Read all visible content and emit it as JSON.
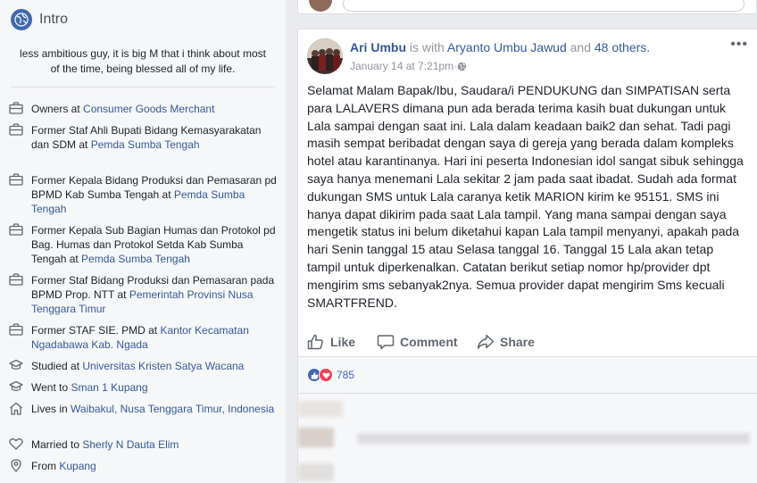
{
  "intro": {
    "title": "Intro",
    "bio": "less ambitious guy, it is big M that i think about most of the time, being blessed all of my life.",
    "items": [
      {
        "icon": "briefcase-icon",
        "prefix": "Owners at ",
        "link": "Consumer Goods Merchant",
        "suffix": ""
      },
      {
        "icon": "briefcase-icon",
        "prefix": "Former Staf Ahli Bupati Bidang Kemasyarakatan dan SDM at ",
        "link": "Pemda Sumba Tengah",
        "suffix": ""
      },
      {
        "icon": "briefcase-icon",
        "prefix": "Former Kepala Bidang Produksi dan Pemasaran pd BPMD Kab Sumba Tengah at ",
        "link": "Pemda Sumba Tengah",
        "suffix": ""
      },
      {
        "icon": "briefcase-icon",
        "prefix": "Former Kepala Sub Bagian Humas dan Protokol pd Bag. Humas dan Protokol Setda Kab Sumba Tengah at ",
        "link": "Pemda Sumba Tengah",
        "suffix": ""
      },
      {
        "icon": "briefcase-icon",
        "prefix": "Former Staf Bidang Produksi dan Pemasaran pada BPMD Prop. NTT at ",
        "link": "Pemerintah Provinsi Nusa Tenggara Timur",
        "suffix": ""
      },
      {
        "icon": "briefcase-icon",
        "prefix": "Former STAF SIE. PMD at ",
        "link": "Kantor Kecamatan Ngadabawa Kab. Ngada",
        "suffix": ""
      },
      {
        "icon": "graduation-cap-icon",
        "prefix": "Studied at ",
        "link": "Universitas Kristen Satya Wacana",
        "suffix": ""
      },
      {
        "icon": "graduation-cap-icon",
        "prefix": "Went to ",
        "link": "Sman 1 Kupang",
        "suffix": ""
      },
      {
        "icon": "home-icon",
        "prefix": "Lives in ",
        "link": "Waibakul, Nusa Tenggara Timur, Indonesia",
        "suffix": ""
      },
      {
        "icon": "heart-icon",
        "prefix": "Married to ",
        "link": "Sherly N Dauta Elim",
        "suffix": ""
      },
      {
        "icon": "location-pin-icon",
        "prefix": "From ",
        "link": "Kupang",
        "suffix": ""
      }
    ]
  },
  "post": {
    "author": "Ari Umbu",
    "with_text": " is with ",
    "tagged": "Aryanto Umbu Jawud",
    "and_text": " and ",
    "others": "48 others.",
    "timestamp": "January 14 at 7:21pm",
    "dot": " · ",
    "more": "•••",
    "text": "Selamat Malam Bapak/Ibu, Saudara/i PENDUKUNG dan SIMPATISAN serta para LALAVERS dimana pun ada berada terima kasih buat dukungan untuk Lala sampai dengan saat ini. Lala dalam keadaan baik2 dan sehat. Tadi pagi masih sempat beribadat dengan saya di gereja yang berada dalam kompleks hotel atau karantinanya. Hari ini peserta Indonesian idol sangat sibuk sehingga saya hanya menemani Lala sekitar 2 jam pada saat ibadat. Sudah ada format dukungan SMS untuk Lala caranya ketik MARION kirim ke 95151. SMS ini hanya dapat dikirim pada saat Lala tampil. Yang mana sampai dengan saya mengetik status ini belum diketahui kapan Lala tampil menyanyi, apakah pada hari Senin tanggal 15 atau Selasa tanggal 16. Tanggal 15 Lala akan tetap tampil untuk diperkenalkan. Catatan berikut setiap nomor hp/provider dpt mengirim sms sebanyak2nya. Semua provider dapat mengirim Sms kecuali SMARTFREND."
  },
  "actions": {
    "like": "Like",
    "comment": "Comment",
    "share": "Share"
  },
  "reactions": {
    "count": "785"
  },
  "colors": {
    "link": "#365899",
    "brand": "#4267b2",
    "love": "#f33e58"
  }
}
